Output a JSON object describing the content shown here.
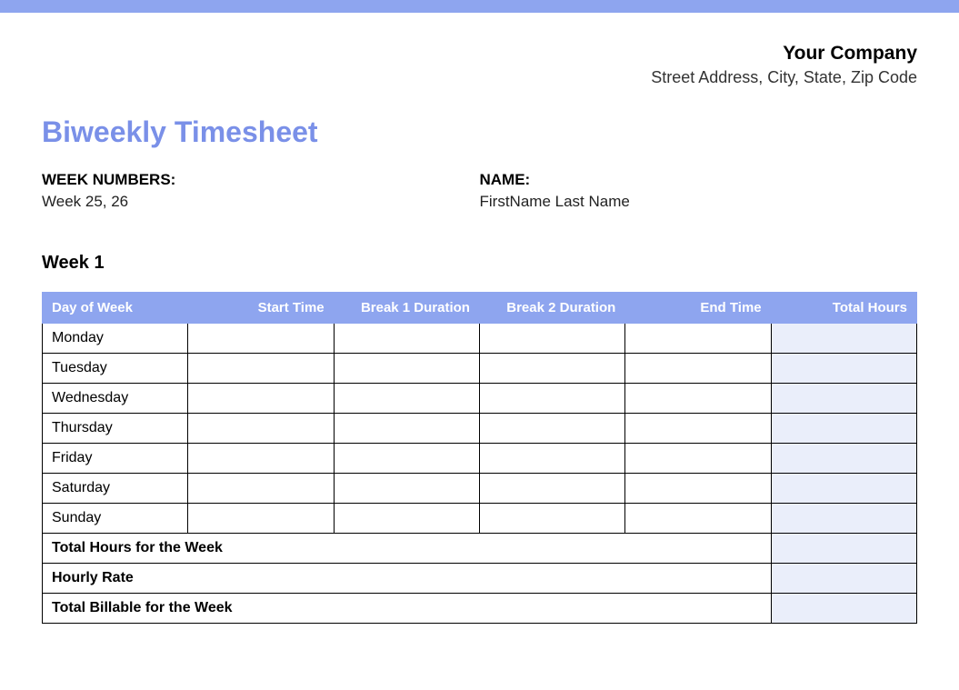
{
  "company": {
    "name": "Your Company",
    "address": "Street Address, City, State, Zip Code"
  },
  "title": "Biweekly Timesheet",
  "meta": {
    "week_numbers_label": "WEEK NUMBERS:",
    "week_numbers_value": "Week 25, 26",
    "name_label": "NAME:",
    "name_value": "FirstName Last Name"
  },
  "week_heading": "Week 1",
  "headers": {
    "day": "Day of Week",
    "start": "Start Time",
    "break1": "Break 1 Duration",
    "break2": "Break 2 Duration",
    "end": "End Time",
    "total": "Total Hours"
  },
  "rows": [
    {
      "day": "Monday",
      "start": "",
      "break1": "",
      "break2": "",
      "end": "",
      "total": ""
    },
    {
      "day": "Tuesday",
      "start": "",
      "break1": "",
      "break2": "",
      "end": "",
      "total": ""
    },
    {
      "day": "Wednesday",
      "start": "",
      "break1": "",
      "break2": "",
      "end": "",
      "total": ""
    },
    {
      "day": "Thursday",
      "start": "",
      "break1": "",
      "break2": "",
      "end": "",
      "total": ""
    },
    {
      "day": "Friday",
      "start": "",
      "break1": "",
      "break2": "",
      "end": "",
      "total": ""
    },
    {
      "day": "Saturday",
      "start": "",
      "break1": "",
      "break2": "",
      "end": "",
      "total": ""
    },
    {
      "day": "Sunday",
      "start": "",
      "break1": "",
      "break2": "",
      "end": "",
      "total": ""
    }
  ],
  "summary": {
    "total_hours_label": "Total Hours for the Week",
    "total_hours_value": "",
    "hourly_rate_label": "Hourly Rate",
    "hourly_rate_value": "",
    "billable_label": "Total Billable for the Week",
    "billable_value": ""
  }
}
